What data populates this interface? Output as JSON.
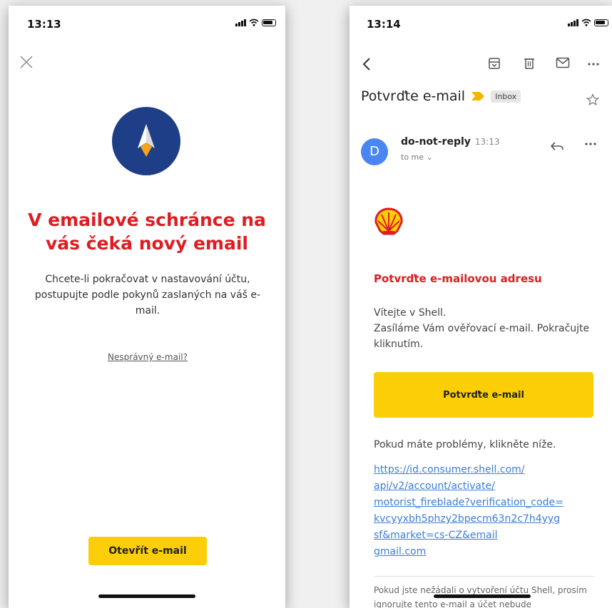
{
  "left_phone": {
    "status_time": "13:13",
    "title": "V emailové schránce na vás čeká nový email",
    "body": "Chcete-li pokračovat v nastavování účtu, postupujte podle pokynů zaslaných na váš e-mail.",
    "wrong_email_link": "Nesprávný e-mail?",
    "open_email_button": "Otevřít e-mail",
    "colors": {
      "title": "#dd1d21",
      "button": "#fbce07",
      "logo_circle": "#1e3f87"
    }
  },
  "right_phone": {
    "status_time": "13:14",
    "subject": "Potvrďte e-mail",
    "label_chip": "Inbox",
    "sender_avatar": "D",
    "sender_name": "do-not-reply",
    "sender_time": "13:13",
    "recipient": "to me ⌄",
    "email_heading": "Potvrďte e-mailovou adresu",
    "email_body": "Vítejte v Shell.\nZasíláme Vám ověřovací e-mail. Pokračujte kliknutím.",
    "confirm_button": "Potvrďte e-mail",
    "problems_text": "Pokud máte problémy, klikněte níže.",
    "link_lines": [
      "https://id.consumer.shell.com/",
      "api/v2/account/activate/",
      "motorist_fireblade?verification_code=",
      "kvcyyxbh5phzy2bpecm63n2c7h4yyg",
      "sf&market=cs-CZ&email",
      "gmail.com"
    ],
    "footer_text": "Pokud jste nežádali o vytvoření účtu Shell, prosím ignorujte tento e-mail a účet nebude",
    "icons": [
      "back-arrow-icon",
      "archive-icon",
      "trash-icon",
      "mail-icon",
      "more-icon",
      "star-icon",
      "reply-icon",
      "shell-logo-icon"
    ],
    "colors": {
      "avatar": "#4a86f2",
      "link": "#3b7ddd",
      "importance": "#f4b400"
    }
  }
}
